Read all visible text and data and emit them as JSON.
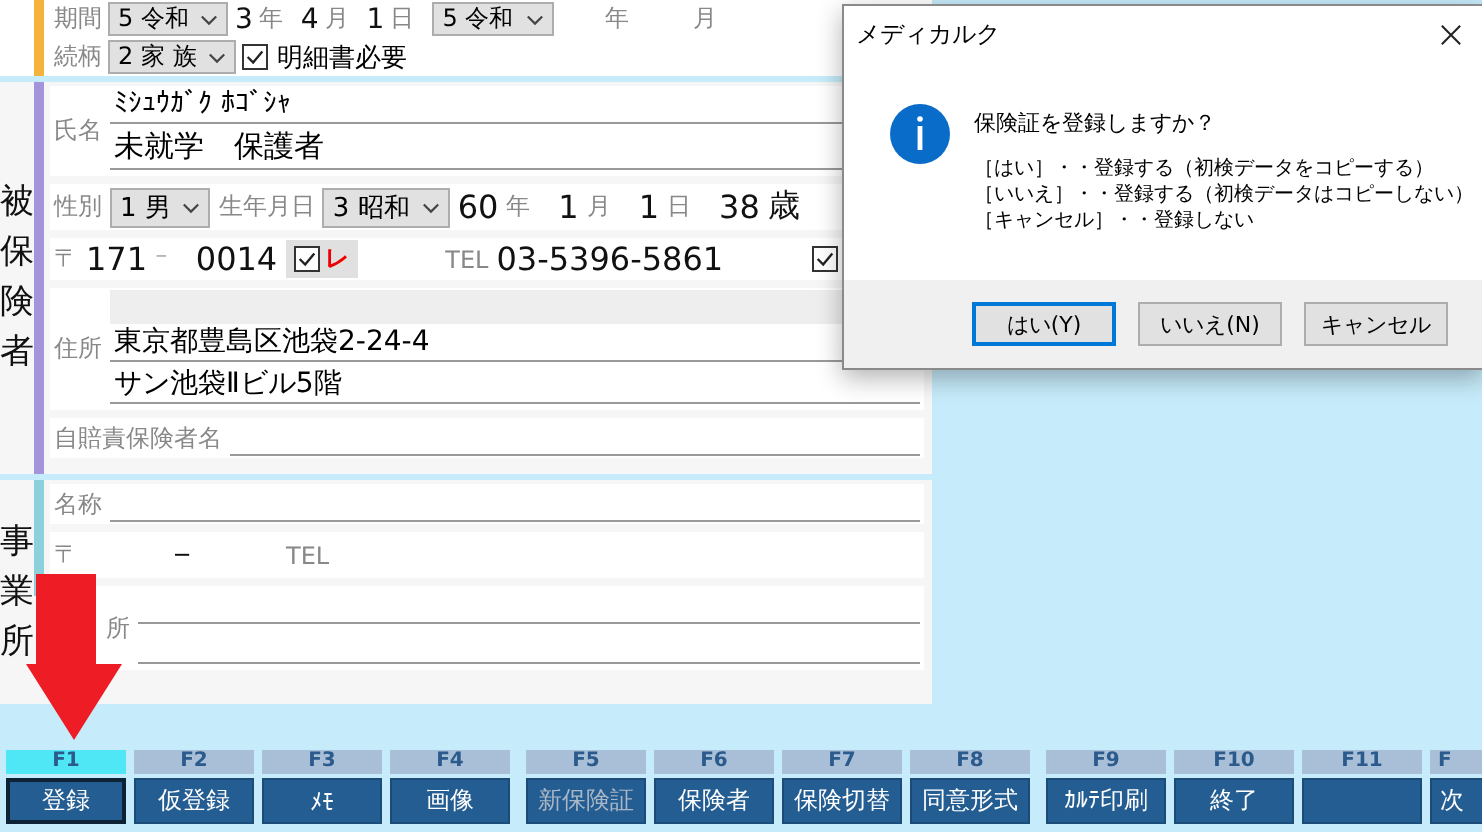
{
  "top_section": {
    "rows": [
      {
        "items": [
          {
            "kind": "label",
            "text": "期間"
          },
          {
            "kind": "select",
            "text": "5 令和"
          },
          {
            "kind": "value",
            "text": "3"
          },
          {
            "kind": "unit",
            "text": "年"
          },
          {
            "kind": "value",
            "text": "4"
          },
          {
            "kind": "unit",
            "text": "月"
          },
          {
            "kind": "value",
            "text": "1"
          },
          {
            "kind": "unit",
            "text": "日"
          },
          {
            "kind": "select",
            "text": "5 令和"
          },
          {
            "kind": "gap"
          },
          {
            "kind": "unit",
            "text": "年"
          },
          {
            "kind": "gap"
          },
          {
            "kind": "unit",
            "text": "月"
          }
        ]
      },
      {
        "items": [
          {
            "kind": "label",
            "text": "続柄"
          },
          {
            "kind": "select",
            "text": "2 家 族"
          },
          {
            "kind": "checkbox",
            "text": "明細書必要",
            "checked": true
          }
        ]
      }
    ]
  },
  "insured": {
    "heading": "被保険者",
    "rows": [
      {
        "items": [
          {
            "kind": "label",
            "text": "氏名"
          },
          {
            "kind": "stack",
            "fields": [
              {
                "kind": "line",
                "text": "ﾐｼｭｳｶﾞｸ ﾎｺﾞｼｬ"
              },
              {
                "kind": "line",
                "text": "未就学　保護者"
              }
            ]
          }
        ]
      },
      {
        "items": [
          {
            "kind": "label",
            "text": "性別"
          },
          {
            "kind": "select",
            "text": "1 男"
          },
          {
            "kind": "label",
            "text": "生年月日"
          },
          {
            "kind": "select",
            "text": "3 昭和"
          },
          {
            "kind": "value",
            "text": "60"
          },
          {
            "kind": "unit",
            "text": "年"
          },
          {
            "kind": "value",
            "text": "1"
          },
          {
            "kind": "unit",
            "text": "月"
          },
          {
            "kind": "value",
            "text": "1"
          },
          {
            "kind": "unit",
            "text": "日"
          },
          {
            "kind": "value",
            "text": "38"
          },
          {
            "kind": "value",
            "text": "歳"
          }
        ]
      },
      {
        "items": [
          {
            "kind": "label",
            "text": "〒"
          },
          {
            "kind": "value",
            "text": "171"
          },
          {
            "kind": "unit",
            "text": "⁻"
          },
          {
            "kind": "value",
            "text": "0014"
          },
          {
            "kind": "flag",
            "text": "レ",
            "checked": true
          },
          {
            "kind": "gap"
          },
          {
            "kind": "label",
            "text": "TEL"
          },
          {
            "kind": "value",
            "text": "03-5396-5861"
          },
          {
            "kind": "gap"
          },
          {
            "kind": "checkbox",
            "checked": true
          }
        ]
      },
      {
        "items": [
          {
            "kind": "label",
            "text": "住所"
          },
          {
            "kind": "stack",
            "fields": [
              {
                "kind": "blank"
              },
              {
                "kind": "line",
                "text": "東京都豊島区池袋2-24-4"
              },
              {
                "kind": "line",
                "text": "サン池袋Ⅱビル5階"
              }
            ]
          }
        ]
      },
      {
        "items": [
          {
            "kind": "label",
            "text": "自賠責保険者名"
          },
          {
            "kind": "line"
          }
        ]
      }
    ]
  },
  "office": {
    "heading": "事業所",
    "rows": [
      {
        "items": [
          {
            "kind": "label",
            "text": "名称"
          },
          {
            "kind": "line"
          }
        ]
      },
      {
        "items": [
          {
            "kind": "label",
            "text": "〒"
          },
          {
            "kind": "gap"
          },
          {
            "kind": "value",
            "text": "－"
          },
          {
            "kind": "gap"
          },
          {
            "kind": "label",
            "text": "TEL"
          }
        ]
      },
      {
        "items": [
          {
            "kind": "label",
            "text": "所"
          },
          {
            "kind": "stack",
            "fields": [
              {
                "kind": "line"
              },
              {
                "kind": "line"
              }
            ]
          }
        ]
      }
    ]
  },
  "function_keys": [
    {
      "key": "F1",
      "label": "登録",
      "selected": true,
      "disabled": false
    },
    {
      "key": "F2",
      "label": "仮登録",
      "selected": false,
      "disabled": false
    },
    {
      "key": "F3",
      "label": "ﾒﾓ",
      "selected": false,
      "disabled": false
    },
    {
      "key": "F4",
      "label": "画像",
      "selected": false,
      "disabled": false
    },
    {
      "key": "F5",
      "label": "新保険証",
      "selected": false,
      "disabled": true
    },
    {
      "key": "F6",
      "label": "保険者",
      "selected": false,
      "disabled": false
    },
    {
      "key": "F7",
      "label": "保険切替",
      "selected": false,
      "disabled": false
    },
    {
      "key": "F8",
      "label": "同意形式",
      "selected": false,
      "disabled": false
    },
    {
      "key": "F9",
      "label": "ｶﾙﾃ印刷",
      "selected": false,
      "disabled": false
    },
    {
      "key": "F10",
      "label": "終了",
      "selected": false,
      "disabled": false
    },
    {
      "key": "F11",
      "selected": false
    },
    {
      "key": "F",
      "label": "次",
      "selected": false,
      "disabled": false
    }
  ],
  "dialog": {
    "title": "メディカルク",
    "question": "保険証を登録しますか？",
    "lines": [
      "［はい］・・登録する（初検データをコピーする）",
      "［いいえ］・・登録する（初検データはコピーしない）",
      "［キャンセル］・・登録しない"
    ],
    "buttons": [
      {
        "label": "はい(Y)",
        "selected": true
      },
      {
        "label": "いいえ(N)",
        "selected": false
      },
      {
        "label": "キャンセル",
        "selected": false
      }
    ]
  }
}
